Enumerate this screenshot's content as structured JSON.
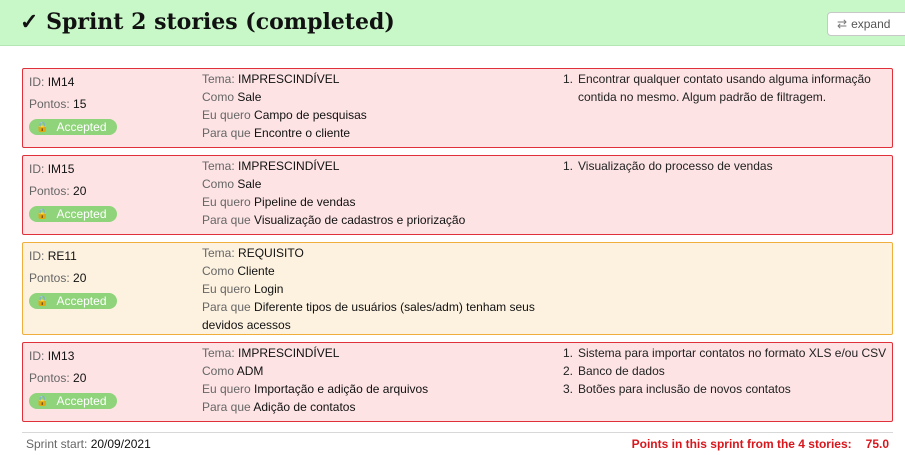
{
  "header": {
    "title": "✓ Sprint 2 stories (completed)",
    "expand_label": "expand",
    "expand_icon": "⇄"
  },
  "labels": {
    "id": "ID:",
    "pontos": "Pontos:",
    "tema": "Tema:",
    "como": "Como",
    "eu_quero": "Eu quero",
    "para_que": "Para que"
  },
  "stories": [
    {
      "id": "IM14",
      "pontos": "15",
      "status": "Accepted",
      "tema": "IMPRESCINDÍVEL",
      "como": "Sale",
      "eu_quero": "Campo de pesquisas",
      "para_que": "Encontre o cliente",
      "criteria": [
        "Encontrar qualquer contato usando alguma informação contida no mesmo. Algum padrão de filtragem."
      ]
    },
    {
      "id": "IM15",
      "pontos": "20",
      "status": "Accepted",
      "tema": "IMPRESCINDÍVEL",
      "como": "Sale",
      "eu_quero": "Pipeline de vendas",
      "para_que": "Visualização de cadastros e priorização",
      "criteria": [
        "Visualização do processo de vendas"
      ]
    },
    {
      "id": "RE11",
      "pontos": "20",
      "status": "Accepted",
      "tema": "REQUISITO",
      "como": "Cliente",
      "eu_quero": "Login",
      "para_que": "Diferente tipos de usuários (sales/adm) tenham seus devidos acessos",
      "criteria": []
    },
    {
      "id": "IM13",
      "pontos": "20",
      "status": "Accepted",
      "tema": "IMPRESCINDÍVEL",
      "como": "ADM",
      "eu_quero": "Importação e adição de arquivos",
      "para_que": "Adição de contatos",
      "criteria": [
        "Sistema para importar contatos no formato XLS e/ou CSV",
        "Banco de dados",
        "Botões para inclusão de novos contatos"
      ]
    }
  ],
  "footer": {
    "sprint_start_label": "Sprint start:",
    "sprint_start_value": "20/09/2021",
    "points_label": "Points in this sprint from the 4 stories:",
    "points_value": "75.0"
  },
  "colors": {
    "header_bg": "#c8f7c8",
    "imprescindivel_border": "#e0303a",
    "imprescindivel_bg": "#fde3e4",
    "requisito_border": "#f0ae3c",
    "requisito_bg": "#fdf2e0",
    "accepted_badge": "#8fd37b",
    "points_text": "#d8161c"
  }
}
